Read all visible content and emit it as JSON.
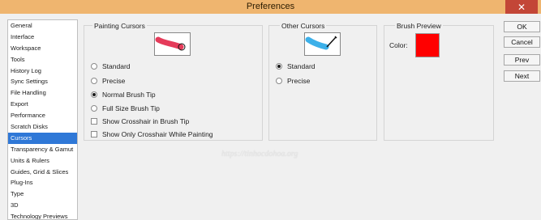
{
  "window": {
    "title": "Preferences"
  },
  "sidebar": {
    "items": [
      {
        "label": "General"
      },
      {
        "label": "Interface"
      },
      {
        "label": "Workspace"
      },
      {
        "label": "Tools"
      },
      {
        "label": "History Log"
      },
      {
        "label": "Sync Settings"
      },
      {
        "label": "File Handling"
      },
      {
        "label": "Export"
      },
      {
        "label": "Performance"
      },
      {
        "label": "Scratch Disks"
      },
      {
        "label": "Cursors",
        "selected": true
      },
      {
        "label": "Transparency & Gamut"
      },
      {
        "label": "Units & Rulers"
      },
      {
        "label": "Guides, Grid & Slices"
      },
      {
        "label": "Plug-Ins"
      },
      {
        "label": "Type"
      },
      {
        "label": "3D"
      },
      {
        "label": "Technology Previews"
      }
    ]
  },
  "painting_cursors": {
    "title": "Painting Cursors",
    "options": [
      {
        "label": "Standard",
        "selected": false
      },
      {
        "label": "Precise",
        "selected": false
      },
      {
        "label": "Normal Brush Tip",
        "selected": true
      },
      {
        "label": "Full Size Brush Tip",
        "selected": false
      }
    ],
    "checkboxes": [
      {
        "label": "Show Crosshair in Brush Tip",
        "checked": false
      },
      {
        "label": "Show Only Crosshair While Painting",
        "checked": false
      }
    ]
  },
  "other_cursors": {
    "title": "Other Cursors",
    "options": [
      {
        "label": "Standard",
        "selected": true
      },
      {
        "label": "Precise",
        "selected": false
      }
    ]
  },
  "brush_preview": {
    "title": "Brush Preview",
    "color_label": "Color:",
    "color": "#ff0000"
  },
  "buttons": {
    "ok": "OK",
    "cancel": "Cancel",
    "prev": "Prev",
    "next": "Next"
  },
  "watermark": "https://tinhocdohoa.org"
}
